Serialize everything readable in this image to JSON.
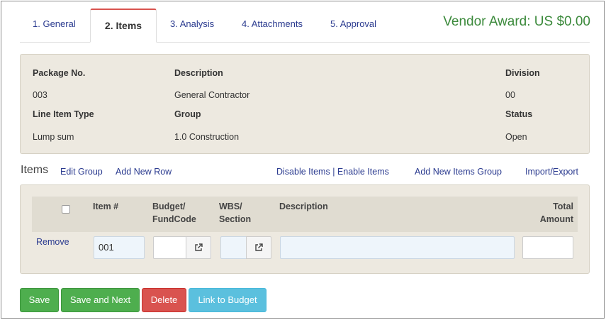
{
  "tabs": [
    {
      "label": "1. General"
    },
    {
      "label": "2. Items"
    },
    {
      "label": "3. Analysis"
    },
    {
      "label": "4. Attachments"
    },
    {
      "label": "5. Approval"
    }
  ],
  "vendor_award": "Vendor Award: US $0.00",
  "info": {
    "package_no_label": "Package No.",
    "package_no_value": "003",
    "description_label": "Description",
    "description_value": "General Contractor",
    "division_label": "Division",
    "division_value": "00",
    "line_item_type_label": "Line Item Type",
    "line_item_type_value": "Lump sum",
    "group_label": "Group",
    "group_value": "1.0 Construction",
    "status_label": "Status",
    "status_value": "Open"
  },
  "items_section": {
    "title": "Items",
    "edit_group": "Edit Group",
    "add_new_row": "Add New Row",
    "disable_enable": "Disable Items | Enable Items",
    "add_new_items_group": "Add New Items Group",
    "import_export": "Import/Export"
  },
  "grid": {
    "headers": {
      "item_no": "Item #",
      "budget_line1": "Budget/",
      "budget_line2": "FundCode",
      "wbs_line1": "WBS/",
      "wbs_line2": "Section",
      "description": "Description",
      "total_line1": "Total",
      "total_line2": "Amount"
    },
    "row": {
      "remove": "Remove",
      "item_no": "001",
      "budget": "",
      "wbs": "",
      "description": "",
      "total": ""
    }
  },
  "buttons": {
    "save": "Save",
    "save_next": "Save and Next",
    "delete": "Delete",
    "link_budget": "Link to Budget"
  },
  "icons": {
    "external": "external-link-icon",
    "checkbox": "checkbox"
  },
  "colors": {
    "accent_link": "#2a3a8f",
    "vendor_award": "#3c8a3c",
    "active_tab_border": "#d9534f",
    "panel_bg": "#ede9e0",
    "save_green": "#4eae4e",
    "delete_red": "#d9534f",
    "link_blue": "#5bc0de"
  }
}
